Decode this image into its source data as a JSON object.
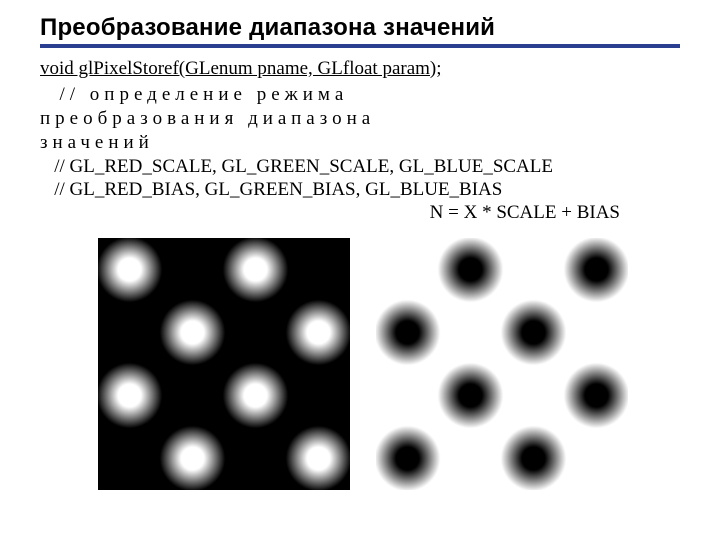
{
  "title": "Преобразование диапазона значений",
  "code_signature": "void glPixelStoref(GLenum pname, GLfloat param);",
  "comment1": "  // определение режима",
  "comment2": "преобразования диапазона",
  "comment3": "значений",
  "const1": "   // GL_RED_SCALE, GL_GREEN_SCALE, GL_BLUE_SCALE",
  "const2": "   // GL_RED_BIAS, GL_GREEN_BIAS, GL_BLUE_BIAS",
  "formula": "N = X * SCALE + BIAS",
  "image_left": {
    "grid": 4,
    "dots": [
      [
        0,
        0
      ],
      [
        0,
        2
      ],
      [
        1,
        1
      ],
      [
        1,
        3
      ],
      [
        2,
        0
      ],
      [
        2,
        2
      ],
      [
        3,
        1
      ],
      [
        3,
        3
      ]
    ],
    "bg": "#000000",
    "dot": "#ffffff"
  },
  "image_right": {
    "grid": 4,
    "dots": [
      [
        0,
        1
      ],
      [
        0,
        3
      ],
      [
        1,
        0
      ],
      [
        1,
        2
      ],
      [
        2,
        1
      ],
      [
        2,
        3
      ],
      [
        3,
        0
      ],
      [
        3,
        2
      ]
    ],
    "bg": "#ffffff",
    "dot": "#000000"
  }
}
